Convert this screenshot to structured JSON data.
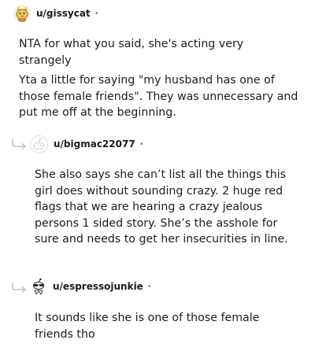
{
  "comments": [
    {
      "username": "u/gissycat",
      "separator": "•",
      "avatar_icon": "snoo-cat-avatar-icon",
      "paragraphs": [
        "NTA for what you said, she's acting very strangely",
        "Yta a little for saying \"my husband has one of those female friends\". They was unnecessary and put me off at the beginning."
      ]
    },
    {
      "username": "u/bigmac22077",
      "separator": "•",
      "avatar_icon": "default-snoo-avatar-icon",
      "reply_icon": "reply-arrow-icon",
      "paragraphs": [
        "She also says she can’t list all the things this girl does without sounding crazy. 2 huge red flags that we are hearing a crazy jealous persons 1 sided story. She’s the asshole for sure and needs to get her insecurities in line."
      ]
    },
    {
      "username": "u/espressojunkie",
      "separator": "•",
      "avatar_icon": "snoo-sunglasses-avatar-icon",
      "reply_icon": "reply-arrow-icon",
      "paragraphs": [
        "It sounds like she is one of those female friends tho"
      ]
    }
  ]
}
